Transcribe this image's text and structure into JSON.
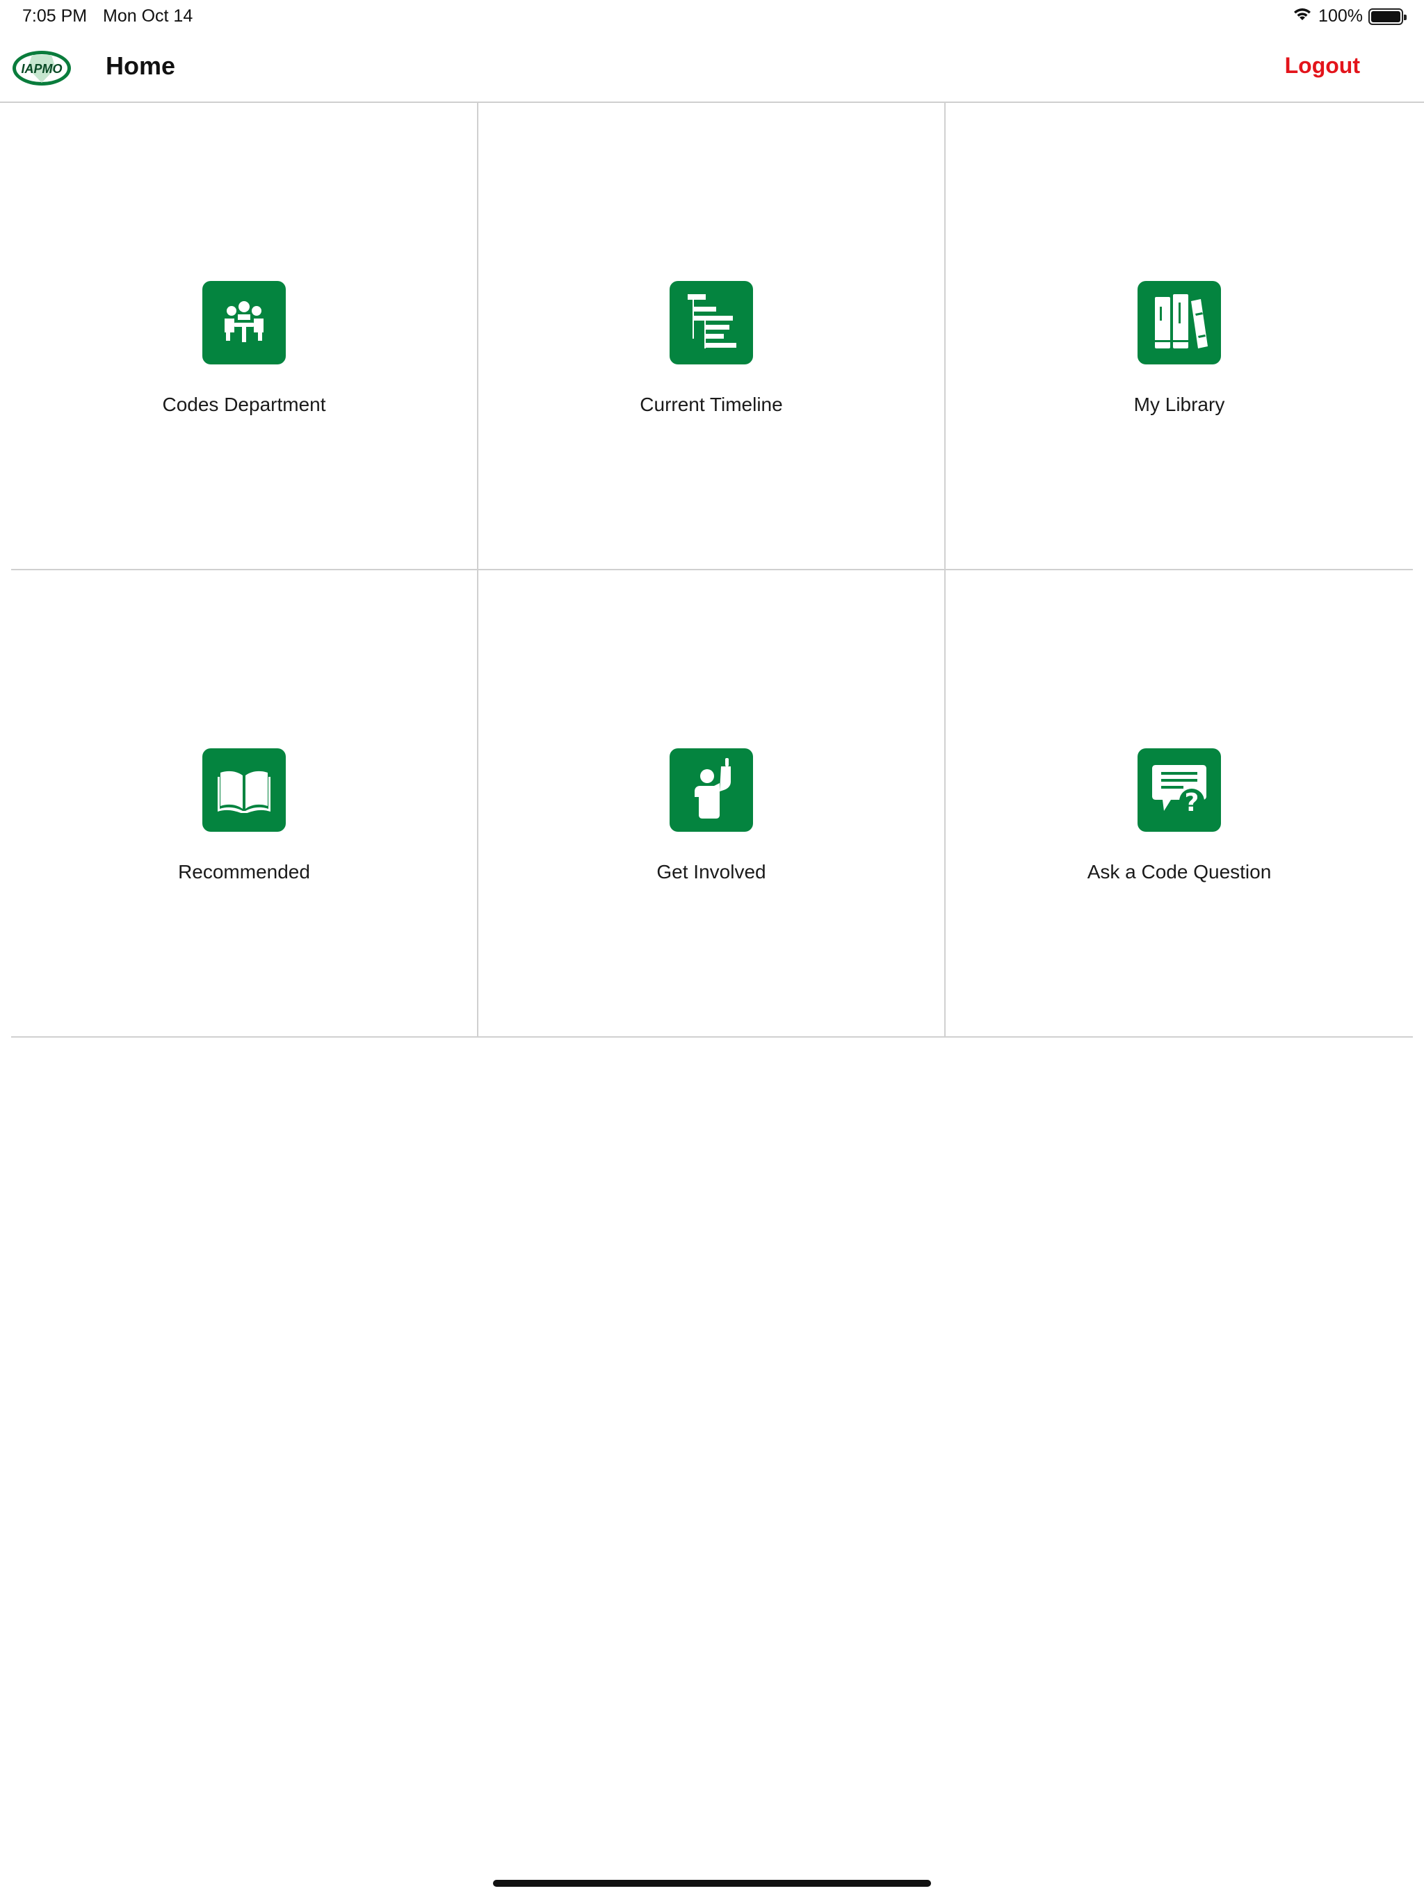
{
  "status_bar": {
    "time": "7:05 PM",
    "date": "Mon Oct 14",
    "battery_percent": "100%",
    "icons": [
      "wifi-icon",
      "battery-icon"
    ]
  },
  "nav": {
    "logo_text": "IAPMO",
    "title": "Home",
    "logout_label": "Logout",
    "logout_color": "#e3141b"
  },
  "tiles": [
    {
      "label": "Codes Department",
      "icon": "meeting-icon"
    },
    {
      "label": "Current Timeline",
      "icon": "timeline-icon"
    },
    {
      "label": "My Library",
      "icon": "books-icon"
    },
    {
      "label": "Recommended",
      "icon": "open-book-icon"
    },
    {
      "label": "Get Involved",
      "icon": "raised-hand-icon"
    },
    {
      "label": "Ask a Code Question",
      "icon": "question-chat-icon"
    }
  ],
  "colors": {
    "tile_icon_bg": "#04843f",
    "accent_red": "#e3141b"
  }
}
